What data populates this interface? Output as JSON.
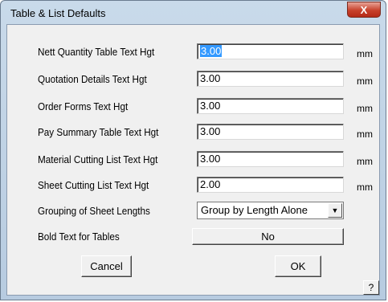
{
  "window": {
    "title": "Table & List Defaults",
    "close_label": "X"
  },
  "fields": [
    {
      "label": "Nett Quantity Table Text Hgt",
      "value": "3.00",
      "unit": "mm"
    },
    {
      "label": "Quotation Details Text Hgt",
      "value": "3.00",
      "unit": "mm"
    },
    {
      "label": "Order Forms Text Hgt",
      "value": "3.00",
      "unit": "mm"
    },
    {
      "label": "Pay Summary Table Text Hgt",
      "value": "3.00",
      "unit": "mm"
    },
    {
      "label": "Material Cutting List Text Hgt",
      "value": "3.00",
      "unit": "mm"
    },
    {
      "label": "Sheet Cutting List Text Hgt",
      "value": "2.00",
      "unit": "mm"
    }
  ],
  "grouping": {
    "label": "Grouping of Sheet Lengths",
    "selected": "Group by Length Alone"
  },
  "bold": {
    "label": "Bold Text for Tables",
    "value": "No"
  },
  "buttons": {
    "cancel": "Cancel",
    "ok": "OK",
    "help": "?"
  }
}
